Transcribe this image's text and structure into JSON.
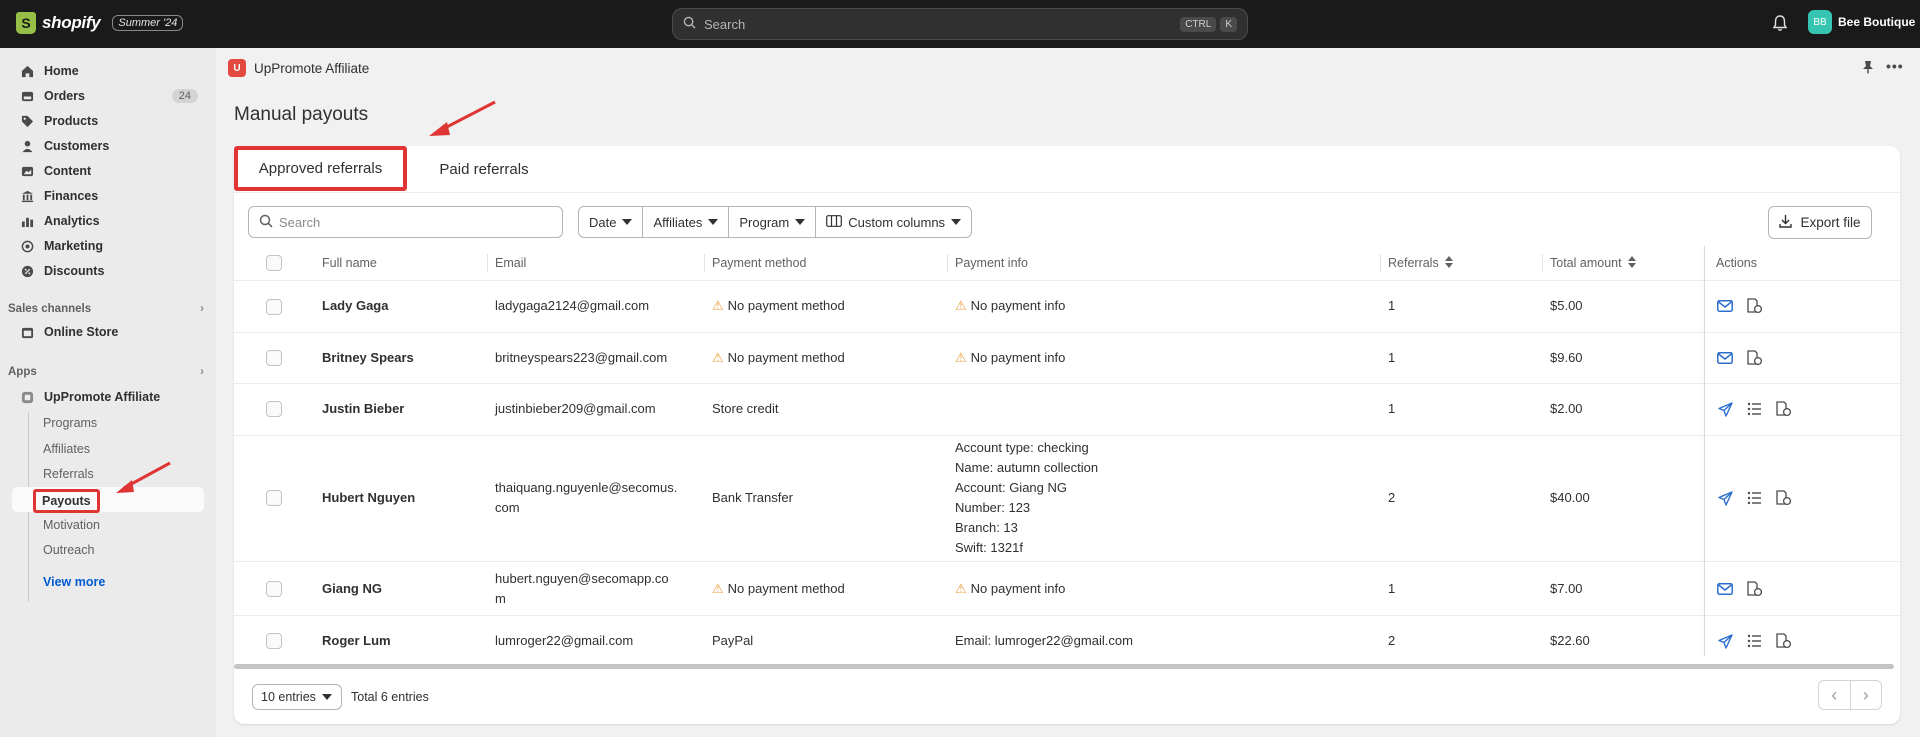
{
  "topbar": {
    "logo_text": "shopify",
    "edition": "Summer '24",
    "search_placeholder": "Search",
    "kbd_ctrl": "CTRL",
    "kbd_k": "K",
    "store_initials": "BB",
    "store_name": "Bee Boutique"
  },
  "sidebar": {
    "items": [
      {
        "label": "Home",
        "icon": "home-icon"
      },
      {
        "label": "Orders",
        "icon": "orders-icon",
        "badge": "24"
      },
      {
        "label": "Products",
        "icon": "tag-icon"
      },
      {
        "label": "Customers",
        "icon": "person-icon"
      },
      {
        "label": "Content",
        "icon": "content-icon"
      },
      {
        "label": "Finances",
        "icon": "bank-icon"
      },
      {
        "label": "Analytics",
        "icon": "bar-chart-icon"
      },
      {
        "label": "Marketing",
        "icon": "target-icon"
      },
      {
        "label": "Discounts",
        "icon": "discount-icon"
      }
    ],
    "sales_channels_label": "Sales channels",
    "online_store": "Online Store",
    "apps_label": "Apps",
    "app_name": "UpPromote Affiliate",
    "sub_items": [
      "Programs",
      "Affiliates",
      "Referrals",
      "Payouts",
      "Motivation",
      "Outreach"
    ],
    "view_more": "View more"
  },
  "app_header": {
    "app_name": "UpPromote Affiliate",
    "logo_letter": "U"
  },
  "page": {
    "title": "Manual payouts",
    "tabs": [
      "Approved referrals",
      "Paid referrals"
    ],
    "search_placeholder": "Search",
    "filters": [
      "Date",
      "Affiliates",
      "Program",
      "Custom columns"
    ],
    "export_label": "Export file"
  },
  "table": {
    "headers": [
      "Full name",
      "Email",
      "Payment method",
      "Payment info",
      "Referrals",
      "Total amount",
      "Actions"
    ],
    "rows": [
      {
        "name": "Lady Gaga",
        "email": "ladygaga2124@gmail.com",
        "method": "No payment method",
        "info": "No payment info",
        "referrals": "1",
        "amount": "$5.00"
      },
      {
        "name": "Britney Spears",
        "email": "britneyspears223@gmail.com",
        "method": "No payment method",
        "info": "No payment info",
        "referrals": "1",
        "amount": "$9.60"
      },
      {
        "name": "Justin Bieber",
        "email": "justinbieber209@gmail.com",
        "method": "Store credit",
        "info": "",
        "referrals": "1",
        "amount": "$2.00"
      },
      {
        "name": "Hubert Nguyen",
        "email_l1": "thaiquang.nguyenle@secomus.",
        "email_l2": "com",
        "method": "Bank Transfer",
        "info_lines": [
          "Account type: checking",
          "Name: autumn collection",
          "Account: Giang NG",
          "Number: 123",
          "Branch: 13",
          "Swift: 1321f"
        ],
        "referrals": "2",
        "amount": "$40.00"
      },
      {
        "name": "Giang NG",
        "email_l1": "hubert.nguyen@secomapp.co",
        "email_l2": "m",
        "method": "No payment method",
        "info": "No payment info",
        "referrals": "1",
        "amount": "$7.00"
      },
      {
        "name": "Roger Lum",
        "email": "lumroger22@gmail.com",
        "method": "PayPal",
        "info": "Email: lumroger22@gmail.com",
        "referrals": "2",
        "amount": "$22.60"
      }
    ]
  },
  "footer": {
    "entries_select": "10 entries",
    "total_label": "Total 6 entries"
  },
  "colors": {
    "accent_red": "#e03535",
    "link_blue": "#005bd3",
    "warning": "#e99e3a"
  }
}
